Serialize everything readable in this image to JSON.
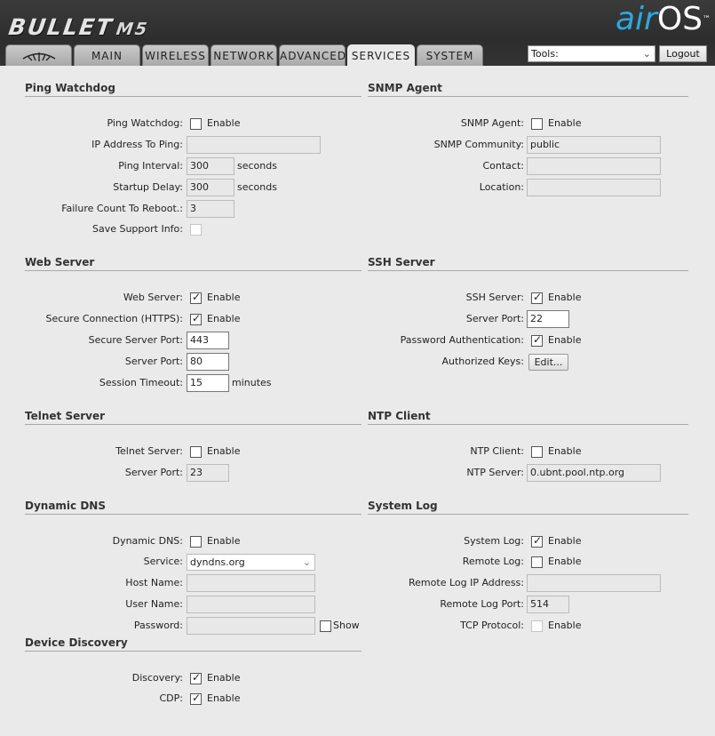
{
  "header": {
    "brand": "BULLET",
    "model": "M5",
    "logo_air": "air",
    "logo_os": "OS",
    "logo_tm": "™"
  },
  "tabs": {
    "logo_icon": "ubiquiti-logo-icon",
    "main": "MAIN",
    "wireless": "WIRELESS",
    "network": "NETWORK",
    "advanced": "ADVANCED",
    "services": "SERVICES",
    "system": "SYSTEM"
  },
  "toolbar": {
    "tools_selected": "Tools:",
    "logout": "Logout"
  },
  "ping": {
    "title": "Ping Watchdog",
    "watchdog_label": "Ping Watchdog:",
    "watchdog_enable": "Enable",
    "watchdog_checked": false,
    "ip_label": "IP Address To Ping:",
    "ip_value": "",
    "interval_label": "Ping Interval:",
    "interval_value": "300",
    "interval_unit": "seconds",
    "startup_label": "Startup Delay:",
    "startup_value": "300",
    "startup_unit": "seconds",
    "failure_label": "Failure Count To Reboot.:",
    "failure_value": "3",
    "support_label": "Save Support Info:"
  },
  "snmp": {
    "title": "SNMP Agent",
    "agent_label": "SNMP Agent:",
    "agent_enable": "Enable",
    "agent_checked": false,
    "community_label": "SNMP Community:",
    "community_value": "public",
    "contact_label": "Contact:",
    "contact_value": "",
    "location_label": "Location:",
    "location_value": ""
  },
  "web": {
    "title": "Web Server",
    "server_label": "Web Server:",
    "server_enable": "Enable",
    "server_checked": true,
    "https_label": "Secure Connection (HTTPS):",
    "https_enable": "Enable",
    "https_checked": true,
    "secure_port_label": "Secure Server Port:",
    "secure_port_value": "443",
    "port_label": "Server Port:",
    "port_value": "80",
    "timeout_label": "Session Timeout:",
    "timeout_value": "15",
    "timeout_unit": "minutes"
  },
  "ssh": {
    "title": "SSH Server",
    "server_label": "SSH Server:",
    "server_enable": "Enable",
    "server_checked": true,
    "port_label": "Server Port:",
    "port_value": "22",
    "password_label": "Password Authentication:",
    "password_enable": "Enable",
    "password_checked": true,
    "keys_label": "Authorized Keys:",
    "keys_button": "Edit..."
  },
  "telnet": {
    "title": "Telnet Server",
    "server_label": "Telnet Server:",
    "server_enable": "Enable",
    "server_checked": false,
    "port_label": "Server Port:",
    "port_value": "23"
  },
  "ntp": {
    "title": "NTP Client",
    "client_label": "NTP Client:",
    "client_enable": "Enable",
    "client_checked": false,
    "server_label": "NTP Server:",
    "server_value": "0.ubnt.pool.ntp.org"
  },
  "ddns": {
    "title": "Dynamic DNS",
    "ddns_label": "Dynamic DNS:",
    "ddns_enable": "Enable",
    "ddns_checked": false,
    "service_label": "Service:",
    "service_value": "dyndns.org",
    "host_label": "Host Name:",
    "host_value": "",
    "user_label": "User Name:",
    "user_value": "",
    "password_label": "Password:",
    "password_value": "",
    "show_label": "Show",
    "show_checked": false
  },
  "syslog": {
    "title": "System Log",
    "log_label": "System Log:",
    "log_enable": "Enable",
    "log_checked": true,
    "remote_label": "Remote Log:",
    "remote_enable": "Enable",
    "remote_checked": false,
    "remote_ip_label": "Remote Log IP Address:",
    "remote_ip_value": "",
    "remote_port_label": "Remote Log Port:",
    "remote_port_value": "514",
    "tcp_label": "TCP Protocol:",
    "tcp_enable": "Enable",
    "tcp_checked": false
  },
  "discovery": {
    "title": "Device Discovery",
    "discovery_label": "Discovery:",
    "discovery_enable": "Enable",
    "discovery_checked": true,
    "cdp_label": "CDP:",
    "cdp_enable": "Enable",
    "cdp_checked": true
  }
}
